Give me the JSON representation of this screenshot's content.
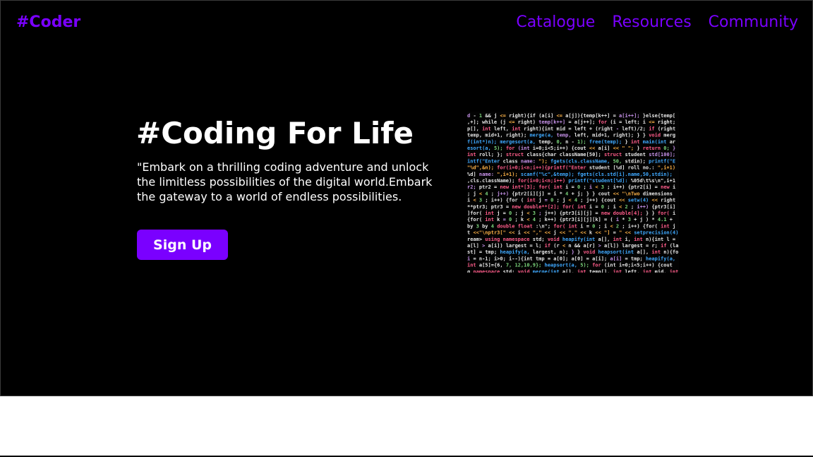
{
  "header": {
    "logo": "#Coder",
    "nav": [
      {
        "label": "Catalogue"
      },
      {
        "label": "Resources"
      },
      {
        "label": "Community"
      }
    ]
  },
  "hero": {
    "title": "#Coding For Life",
    "tagline": "\"Embark on a thrilling coding adventure and unlock the limitless possibilities of the digital world.Embark the gateway to a world of endless possibilities.",
    "signup_label": "Sign Up"
  },
  "code_image": {
    "icon": "code-screenshot-image",
    "lines": [
      "d - 1 && j <= right){if (a[i] <= a[j]){temp[k++] = a[i++]; }else{temp[",
      ",+]; while (j <= right) temp[k++] = a[j++]; for (i = left; i <= right;",
      "p[], int left, int right){int mid = left + (right - left)/2; if (right",
      "temp, mid+1, right); merge(a, temp, left, mid+1, right); } } void merg",
      "f(int*)n); mergesort(a, temp, 0, n - 1); free(temp); } int main(int ar",
      "esort(a, 5); for (int i=0;i<5;i++) {cout << a[i] << \" \"; } return 0; }",
      "int roll; }; struct class{char className[50]; struct student std[100];",
      "intf(\"Enter class name: \"); fgets(cls.className, 50, stdin); printf(\"E",
      "\"%d\",&n); for(i=0;i<n;i++){printf(\"Enter student [%d] roll no.: \",i+1)",
      "%d] name: \",i+1); scanf(\"%c\",&temp); fgets(cls.std[i].name,50,stdin);",
      ",cls.className); for(i=0;i<n;i++) printf(\"student[%d]: %05d\\t%s\\n\",i+1",
      "r2; ptr2 = new int*[3]; for( int i = 0 ; i < 3 ; i++) {ptr2[i] = new i",
      "; j < 4 ; j++) {ptr2[i][j] = i * 4 + j; } } cout << \"\\nTwo dimensions",
      " i < 3 ; i++) {for ( int j = 0 ; j < 4 ; j++) {cout << setw(4) << right",
      "**ptr3; ptr3 = new double**[2]; for( int i = 0 ; i < 2 ; i++) {ptr3[i]",
      "]for( int j = 0 ; j < 3 ; j++) {ptr3[i][j] = new double[4]; } } for( i",
      "{for( int k = 0 ; k < 4 ; k++) {ptr3[i][j][k] = ( i * 3 + j ) * 4.1 +",
      "by 3 by 4 double float :\\n\"; for( int i = 0 ; i < 2 ; i++) {for( int j",
      "t <<\"\\nptr3[\" << i << \",\" << j << \",\" << k << \"] = \" << setprecision(4)",
      "ream> using namespace std; void heapify(int a[], int i, int n){int l =",
      "a[l] > a[i]) largest = l; if (r < n && a[r] > a[l]) largest = r; if (la",
      "st] = tmp; heapify(a, largest, n); } } void heapsort(int a[], int n){fo",
      "i = n-1; i>0; i--){int tmp = a[0]; a[0] = a[i]; a[i] = tmp; heapify(a,",
      "int a[5]={6, 7, 12,10,9}; heapsort(a, 5); for (int i=0;i<5;i++) {cout",
      "g namespace std; void merge(int a[], int temp[], int left, int mid, int"
    ]
  },
  "colors": {
    "accent": "#7a00ff",
    "background": "#000000",
    "text": "#ffffff",
    "code_palette": [
      "#e6e6e6",
      "#ff5c8a",
      "#3fa9ff",
      "#ffb347",
      "#7cd67c",
      "#c792ea"
    ]
  }
}
